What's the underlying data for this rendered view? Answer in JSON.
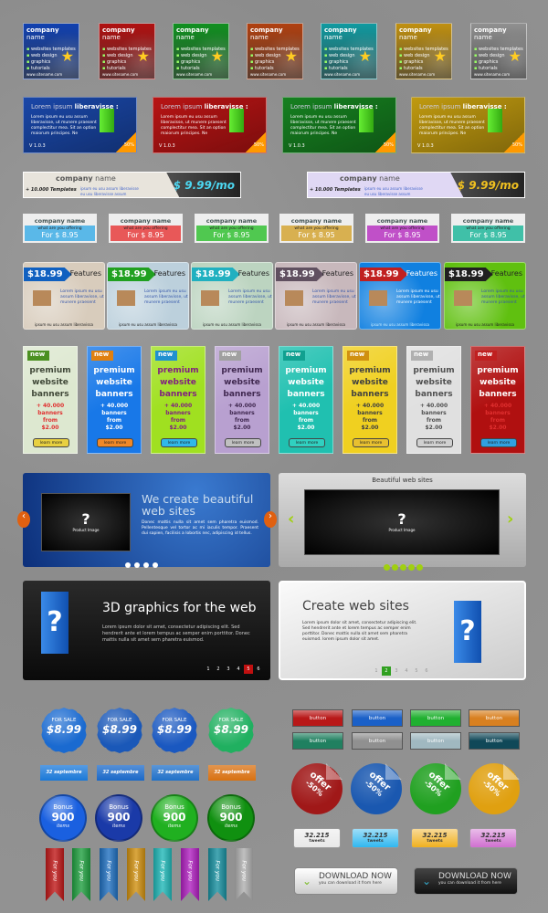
{
  "company_boxes": {
    "title_bold": "company",
    "title_rest": "name",
    "items": [
      "websites templates",
      "web design",
      "graphics",
      "tutorials"
    ],
    "site": "www.sitename.com",
    "colors": [
      "#1040b0",
      "#b01010",
      "#109020",
      "#b04010",
      "#109aa0",
      "#c09010",
      "#909090"
    ]
  },
  "lorem_banners": {
    "title": "Lorem ipsum",
    "title_bold": "liberavisse :",
    "text": "Lorem ipsum eu usu assum liberavisse, ut munere praesent complectitur mea. Sit an option maiorum principes. Ne",
    "version": "V 1.0.3",
    "badge": "50%",
    "colors": [
      "#1a47a8",
      "#b81414",
      "#168020",
      "#c09a10"
    ]
  },
  "wide_banners": [
    {
      "title_bold": "company",
      "title_rest": "name",
      "tagline": "+ 10.000 Templates",
      "bullets": [
        "ipsum eu usu assum liberavisse",
        "eu usu liberavisse assum"
      ],
      "price": "$ 9.99/mo",
      "price_color": "#4cd6f0",
      "bg": "#e8e4dc"
    },
    {
      "title_bold": "company",
      "title_rest": "name",
      "tagline": "+ 10.000 Templates",
      "bullets": [
        "ipsum eu usu assum liberavisse",
        "eu usu liberavisse assum"
      ],
      "price": "$ 9.99/mo",
      "price_color": "#f0c020",
      "bg": "#e0d8f4"
    }
  ],
  "small_boxes": {
    "title": "company name",
    "offer": "what are you offering",
    "price": "For $ 8.95",
    "colors": [
      "#5ab8e8",
      "#e85858",
      "#50c850",
      "#d8b050",
      "#c050c8",
      "#40c0a8"
    ]
  },
  "feature_boxes": {
    "price": "$18.99",
    "label": "Features",
    "text": "Lorem ipsum eu usu assum liberavisse, ut munere praesent",
    "footer": "ipsum eu usu assum liberavissa",
    "bg": [
      "#d8ccbc",
      "#bcd0dc",
      "#bcd4c0",
      "#c8b8bc",
      "#1080e0",
      "#60c010"
    ],
    "tag": [
      "#1060c0",
      "#20a020",
      "#20b0c0",
      "#605060",
      "#c02020",
      "#202020"
    ]
  },
  "skyscrapers": {
    "badge": "new",
    "title": [
      "premium",
      "website",
      "banners"
    ],
    "lines": [
      "+ 40.000",
      "banners",
      "from",
      "$2.00"
    ],
    "button": "learn more",
    "bg": [
      "#dde8d0",
      "#1878e8",
      "#a0e020",
      "#b8a0d0",
      "#20c0b0",
      "#f0d020",
      "#e0e0e0",
      "#b01010"
    ],
    "fg": [
      "#404838",
      "#ffffff",
      "#802080",
      "#402850",
      "#ffffff",
      "#404040",
      "#505050",
      "#ffffff"
    ]
  },
  "slider_blue": {
    "title": "We create beautiful web sites",
    "text": "Donec mattis nulla sit amet sem pharetra euismod. Pellentesque vel tortor ac mi iaculis tempor. Praesent dui sapien, facilisis a lobortis nec, adipiscing id tellus.",
    "image_label": "Product Image",
    "image_glyph": "?",
    "dots": 4
  },
  "slider_silver": {
    "title": "Beautiful web sites",
    "image_label": "Product Image",
    "image_glyph": "?",
    "dots": 5,
    "accent": "#a0d010"
  },
  "slider_dark": {
    "title": "3D graphics for the web",
    "text": "Lorem ipsum dolor sit amet, consectetur adipiscing elit. Sed hendrerit ante et lorem tempus ac semper enim porttitor. Donec mattis nulla sit amet sem pharetra euismod.",
    "pages": [
      "1",
      "2",
      "3",
      "4",
      "5",
      "6"
    ],
    "active_page": "5",
    "glyph": "?"
  },
  "slider_light": {
    "title": "Create web sites",
    "text": "Lorem ipsum dolor sit amet, consectetur adipiscing elit. Sed hendrerit ante et lorem tempus ac semper enim porttitor. Donec mattis nulla sit amet sem pharetra euismod. lorem ipsum dolor sit amet.",
    "pages": [
      "1",
      "2",
      "3",
      "4",
      "5",
      "6"
    ],
    "active_page": "2",
    "glyph": "?"
  },
  "sale_badges": {
    "label": "FOR SALE",
    "price": "$8.99",
    "colors": [
      "#1a6ad0",
      "#1a58b8",
      "#1a58c0",
      "#20b060"
    ]
  },
  "date_tags": {
    "label": "32 septembre",
    "colors": [
      "#1a78d8",
      "#1a68c8",
      "#2070c8",
      "#d87010"
    ]
  },
  "bonus": {
    "label": "Bonus",
    "value": "900",
    "unit": "items",
    "colors": [
      "#1a60e0",
      "#1a3aa8",
      "#20b020",
      "#109010"
    ]
  },
  "ribbons": {
    "label": "For you",
    "colors": [
      "#c01818",
      "#20a040",
      "#2070c0",
      "#d09010",
      "#20b8b8",
      "#b020c0",
      "#1890a0",
      "#b0b0b0"
    ]
  },
  "buttons": {
    "label": "button",
    "colors": [
      "#b81818",
      "#1a60c8",
      "#20b030",
      "#d88020",
      "#208060",
      "#909090",
      "#a0b8c0",
      "#104858"
    ]
  },
  "offers": {
    "label": "offer",
    "value": "-50%",
    "colors": [
      "#a01818",
      "#1a58b0",
      "#20a020",
      "#e0a010"
    ]
  },
  "tweets": {
    "count": "32.215",
    "label": "tweets",
    "colors": [
      "#e8e8e8",
      "#30b8f0",
      "#f0b020",
      "#d070d0"
    ]
  },
  "downloads": [
    {
      "title": "DOWNLOAD NOW",
      "subtitle": "you can download it from here",
      "theme": "light"
    },
    {
      "title": "DOWNLOAD NOW",
      "subtitle": "you can download it from here",
      "theme": "dark"
    }
  ]
}
